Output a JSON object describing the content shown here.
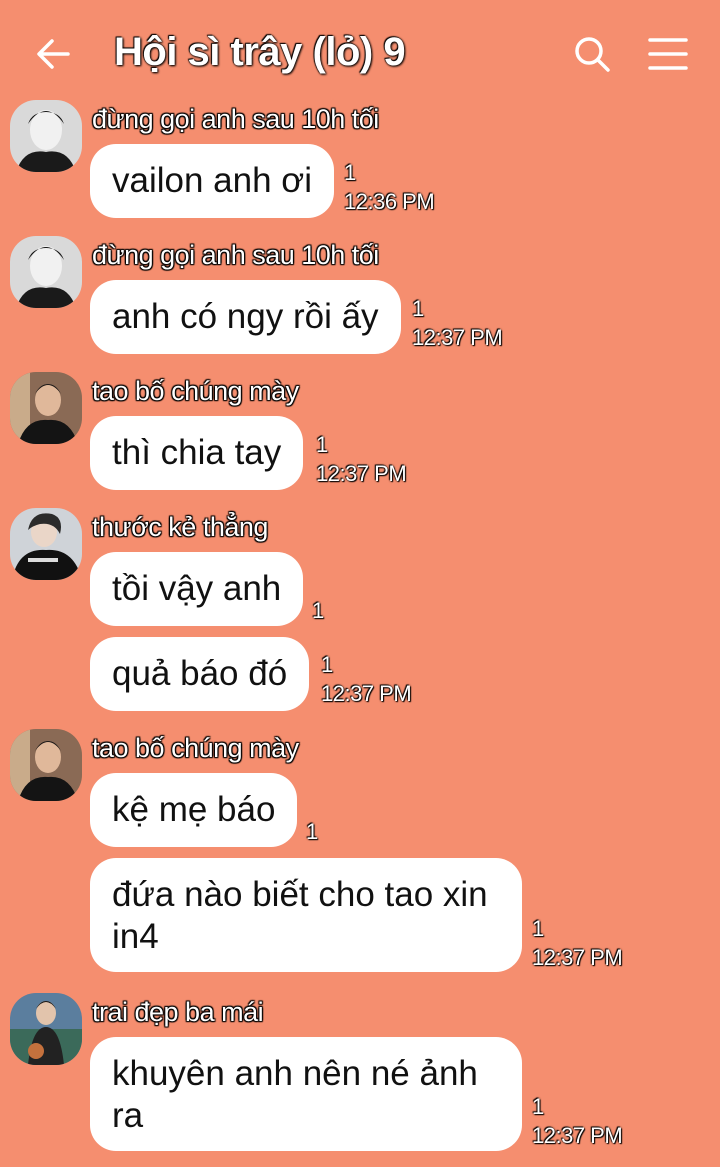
{
  "header": {
    "title": "Hội sì trây (lỏ) 9",
    "back_icon": "arrow-left-icon",
    "search_icon": "search-icon",
    "menu_icon": "hamburger-menu-icon"
  },
  "colors": {
    "background": "#f58e6f",
    "bubble": "#ffffff"
  },
  "messages": [
    {
      "sender": "đừng gọi anh sau 10h tối",
      "text": "vailon anh ơi",
      "count": "1",
      "time": "12:36 PM"
    },
    {
      "sender": "đừng gọi anh sau 10h tối",
      "text": "anh có ngy rồi ấy",
      "count": "1",
      "time": "12:37 PM"
    },
    {
      "sender": "tao bố chúng mày",
      "text": "thì chia tay",
      "count": "1",
      "time": "12:37 PM"
    },
    {
      "sender": "thước kẻ thẳng",
      "text": "tồi vậy anh",
      "count": "1",
      "time": ""
    },
    {
      "sender": "",
      "text": "quả báo đó",
      "count": "1",
      "time": "12:37 PM"
    },
    {
      "sender": "tao bố chúng mày",
      "text": "kệ mẹ báo",
      "count": "1",
      "time": ""
    },
    {
      "sender": "",
      "text": "đứa nào biết cho tao xin in4",
      "count": "1",
      "time": "12:37 PM"
    },
    {
      "sender": "trai đẹp ba mái",
      "text": "khuyên anh nên né ảnh ra",
      "count": "1",
      "time": "12:37 PM"
    }
  ]
}
